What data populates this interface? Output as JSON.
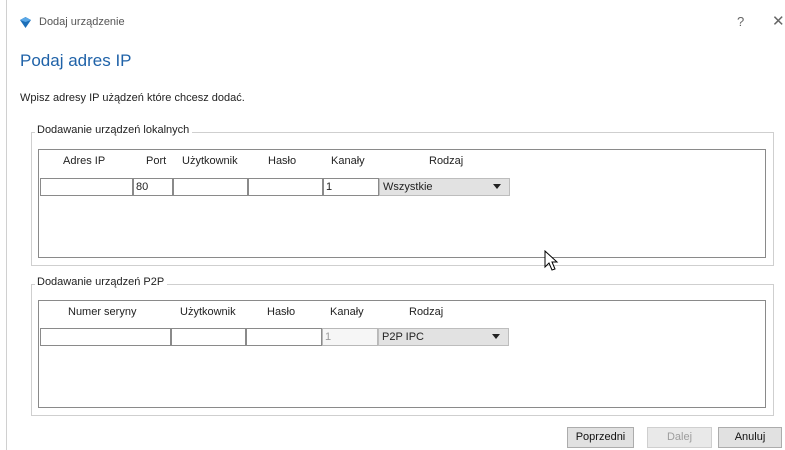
{
  "window": {
    "title": "Dodaj urządzenie",
    "help_label": "?",
    "close_label": "✕"
  },
  "page": {
    "title": "Podaj adres IP",
    "instructions": "Wpisz adresy IP użądzeń które chcesz dodać."
  },
  "local_group": {
    "title": "Dodawanie urządzeń lokalnych",
    "columns": [
      "Adres IP",
      "Port",
      "Użytkownik",
      "Hasło",
      "Kanały",
      "Rodzaj"
    ],
    "row": {
      "ip": "",
      "port": "80",
      "user": "",
      "password": "",
      "channels": "1",
      "type": "Wszystkie"
    }
  },
  "p2p_group": {
    "title": "Dodawanie urządzeń P2P",
    "columns": [
      "Numer seryny",
      "Użytkownik",
      "Hasło",
      "Kanały",
      "Rodzaj"
    ],
    "row": {
      "serial": "",
      "user": "",
      "password": "",
      "channels": "1",
      "type": "P2P IPC"
    }
  },
  "footer": {
    "prev_label": "Poprzedni",
    "next_label": "Dalej",
    "cancel_label": "Anuluj"
  }
}
